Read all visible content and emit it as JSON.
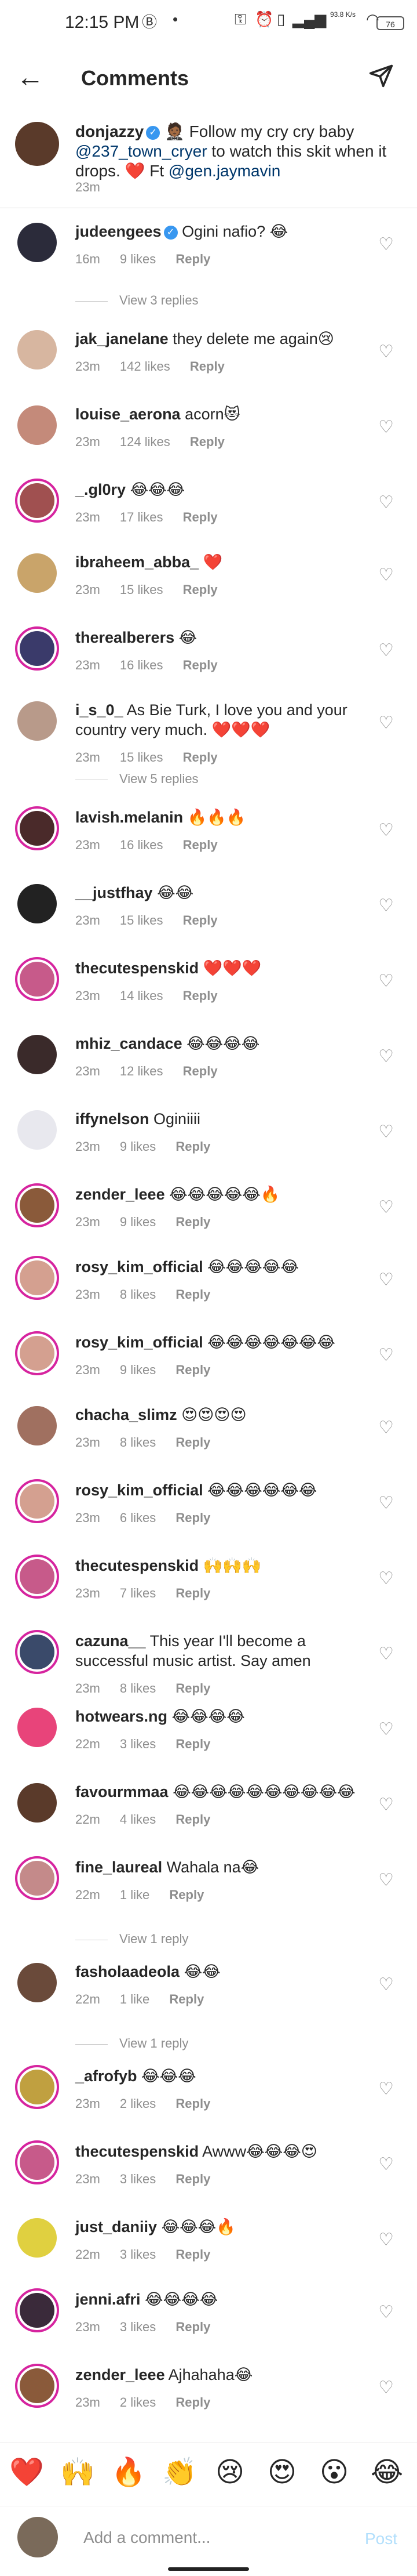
{
  "status": {
    "time": "12:15 PM",
    "battery": "76",
    "net": "93.8 K/s"
  },
  "header": {
    "title": "Comments"
  },
  "caption": {
    "username": "donjazzy",
    "text_part1": " 🤵🏾 Follow my cry cry baby ",
    "mention1": "@237_town_cryer",
    "text_part2": " to watch this skit when it drops. ❤️ Ft ",
    "mention2": "@gen.jaymavin",
    "time": "23m"
  },
  "comments": [
    {
      "user": "judeengees",
      "verified": true,
      "text": "Ogini nafio? 😂",
      "time": "16m",
      "likes": "9 likes",
      "reply": "Reply",
      "avatar_color": "#2b2b3a",
      "ring": false
    },
    {
      "user": "jak_janelane",
      "text": "they delete me again😢",
      "time": "23m",
      "likes": "142 likes",
      "reply": "Reply",
      "avatar_color": "#d7b6a0",
      "ring": false
    },
    {
      "user": "louise_aerona",
      "text": "acorn😻",
      "time": "23m",
      "likes": "124 likes",
      "reply": "Reply",
      "avatar_color": "#c48a7a",
      "ring": false
    },
    {
      "user": "_.gl0ry",
      "text": "😂😂😂",
      "time": "23m",
      "likes": "17 likes",
      "reply": "Reply",
      "avatar_color": "#a05050",
      "ring": true
    },
    {
      "user": "ibraheem_abba_",
      "text": "❤️",
      "time": "23m",
      "likes": "15 likes",
      "reply": "Reply",
      "avatar_color": "#c9a46a",
      "ring": false
    },
    {
      "user": "therealberers",
      "text": "😂",
      "time": "23m",
      "likes": "16 likes",
      "reply": "Reply",
      "avatar_color": "#3a3a6a",
      "ring": true
    },
    {
      "user": "i_s_0_",
      "text": "As Bie Turk, I love you and your country very much. ❤️❤️❤️",
      "time": "23m",
      "likes": "15 likes",
      "reply": "Reply",
      "avatar_color": "#b89a8a",
      "ring": false
    },
    {
      "user": "lavish.melanin",
      "text": "🔥🔥🔥",
      "time": "23m",
      "likes": "16 likes",
      "reply": "Reply",
      "avatar_color": "#4a2a2a",
      "ring": true
    },
    {
      "user": "__justfhay",
      "text": "😂😂",
      "time": "23m",
      "likes": "15 likes",
      "reply": "Reply",
      "avatar_color": "#222222",
      "ring": false
    },
    {
      "user": "thecutespenskid",
      "text": "❤️❤️❤️",
      "time": "23m",
      "likes": "14 likes",
      "reply": "Reply",
      "avatar_color": "#c75a8a",
      "ring": true
    },
    {
      "user": "mhiz_candace",
      "text": "😂😂😂😂",
      "time": "23m",
      "likes": "12 likes",
      "reply": "Reply",
      "avatar_color": "#3a2a2a",
      "ring": false
    },
    {
      "user": "iffynelson",
      "text": "Oginiiii",
      "time": "23m",
      "likes": "9 likes",
      "reply": "Reply",
      "avatar_color": "#e8e8ee",
      "ring": false
    },
    {
      "user": "zender_leee",
      "text": "😂😂😂😂😂🔥",
      "time": "23m",
      "likes": "9 likes",
      "reply": "Reply",
      "avatar_color": "#8a5a3a",
      "ring": true
    },
    {
      "user": "rosy_kim_official",
      "text": "😂😂😂😂😂",
      "time": "23m",
      "likes": "8 likes",
      "reply": "Reply",
      "avatar_color": "#d4a090",
      "ring": true
    },
    {
      "user": "rosy_kim_official",
      "text": "😂😂😂😂😂😂😂",
      "time": "23m",
      "likes": "9 likes",
      "reply": "Reply",
      "avatar_color": "#d4a090",
      "ring": true
    },
    {
      "user": "chacha_slimz",
      "text": "😍😍😍😍",
      "time": "23m",
      "likes": "8 likes",
      "reply": "Reply",
      "avatar_color": "#a07060",
      "ring": false
    },
    {
      "user": "rosy_kim_official",
      "text": "😂😂😂😂😂😂",
      "time": "23m",
      "likes": "6 likes",
      "reply": "Reply",
      "avatar_color": "#d4a090",
      "ring": true
    },
    {
      "user": "thecutespenskid",
      "text": "🙌🙌🙌",
      "time": "23m",
      "likes": "7 likes",
      "reply": "Reply",
      "avatar_color": "#c75a8a",
      "ring": true
    },
    {
      "user": "cazuna__",
      "text": "This year I'll become a successful music artist. Say amen",
      "time": "23m",
      "likes": "8 likes",
      "reply": "Reply",
      "avatar_color": "#3a4a6a",
      "ring": true
    },
    {
      "user": "hotwears.ng",
      "text": "😂😂😂😂",
      "time": "22m",
      "likes": "3 likes",
      "reply": "Reply",
      "avatar_color": "#e8447a",
      "ring": false
    },
    {
      "user": "favourmmaa",
      "text": "😂😂😂😂😂😂😂😂😂😂",
      "time": "22m",
      "likes": "4 likes",
      "reply": "Reply",
      "avatar_color": "#5a3a2a",
      "ring": false
    },
    {
      "user": "fine_laureal",
      "text": "Wahala na😂",
      "time": "22m",
      "likes": "1 like",
      "reply": "Reply",
      "avatar_color": "#c48a8a",
      "ring": true
    },
    {
      "user": "fasholaadeola",
      "text": "😂😂",
      "time": "22m",
      "likes": "1 like",
      "reply": "Reply",
      "avatar_color": "#6a4a3a",
      "ring": false
    },
    {
      "user": "_afrofyb",
      "text": "😂😂😂",
      "time": "23m",
      "likes": "2 likes",
      "reply": "Reply",
      "avatar_color": "#c0a040",
      "ring": true
    },
    {
      "user": "thecutespenskid",
      "text": "Awww😂😂😂😍",
      "time": "23m",
      "likes": "3 likes",
      "reply": "Reply",
      "avatar_color": "#c75a8a",
      "ring": true
    },
    {
      "user": "just_daniiy",
      "text": "😂😂😂🔥",
      "time": "22m",
      "likes": "3 likes",
      "reply": "Reply",
      "avatar_color": "#e0d040",
      "ring": false
    },
    {
      "user": "jenni.afri",
      "text": "😂😂😂😂",
      "time": "23m",
      "likes": "3 likes",
      "reply": "Reply",
      "avatar_color": "#3a2a3a",
      "ring": true
    },
    {
      "user": "zender_leee",
      "text": "Ajhahaha😂",
      "time": "23m",
      "likes": "2 likes",
      "reply": "Reply",
      "avatar_color": "#8a5a3a",
      "ring": true
    }
  ],
  "view_replies": [
    "View 3 replies",
    "View 5 replies",
    "View 1 reply",
    "View 1 reply"
  ],
  "reactions": [
    "❤️",
    "🙌",
    "🔥",
    "👏",
    "😢",
    "😍",
    "😮",
    "😂"
  ],
  "input": {
    "placeholder": "Add a comment...",
    "post": "Post"
  }
}
